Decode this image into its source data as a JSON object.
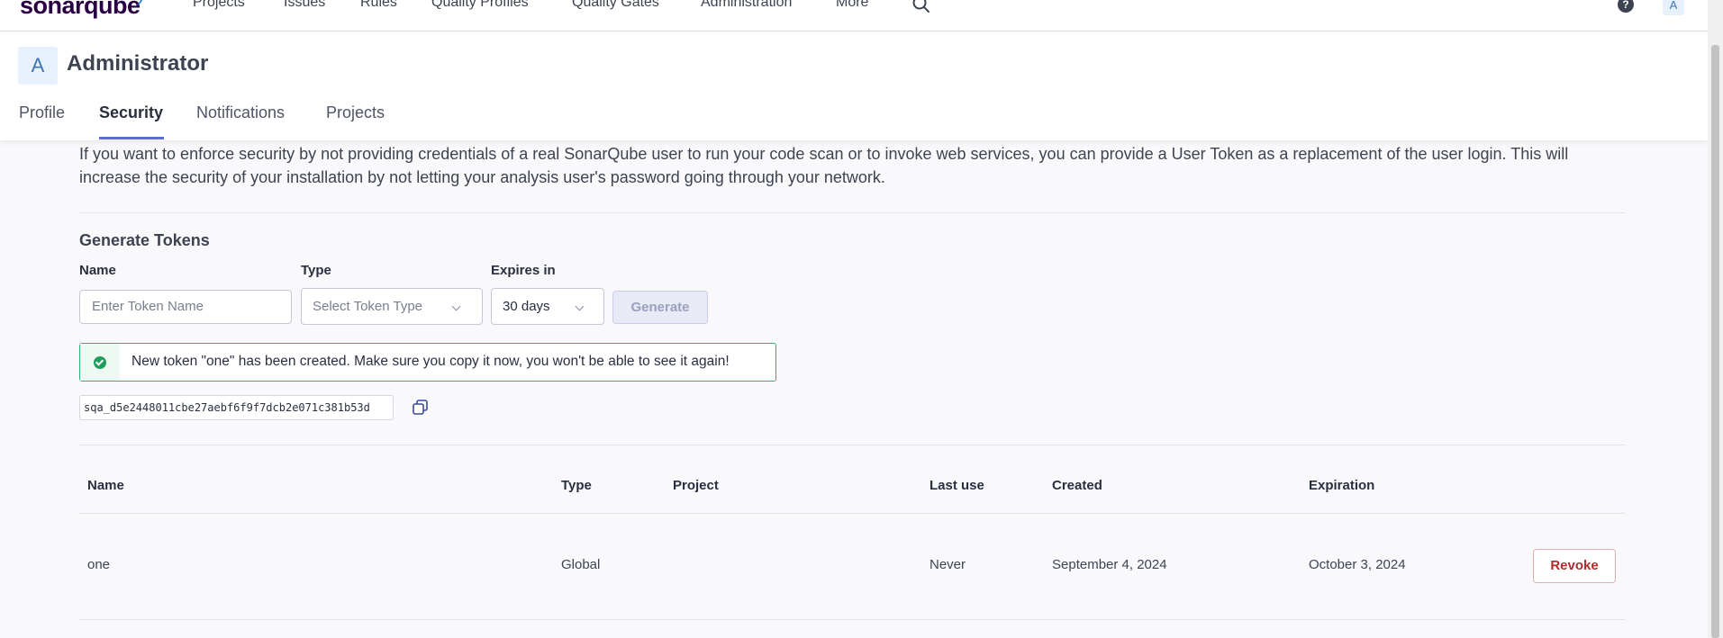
{
  "nav": {
    "logo": "sonarqube",
    "items": [
      "Projects",
      "Issues",
      "Rules",
      "Quality Profiles",
      "Quality Gates",
      "Administration",
      "More"
    ],
    "help": "?",
    "avatar_initial": "A"
  },
  "account": {
    "avatar_initial": "A",
    "name": "Administrator",
    "tabs": [
      "Profile",
      "Security",
      "Notifications",
      "Projects"
    ],
    "active_tab": "Security"
  },
  "security": {
    "description": "If you want to enforce security by not providing credentials of a real SonarQube user to run your code scan or to invoke web services, you can provide a User Token as a replacement of the user login. This will increase the security of your installation by not letting your analysis user's password going through your network.",
    "generate_title": "Generate Tokens",
    "form": {
      "name_label": "Name",
      "name_placeholder": "Enter Token Name",
      "type_label": "Type",
      "type_placeholder": "Select Token Type",
      "expires_label": "Expires in",
      "expires_value": "30 days",
      "generate_label": "Generate"
    },
    "alert": "New token \"one\" has been created. Make sure you copy it now, you won't be able to see it again!",
    "token_value": "sqa_d5e2448011cbe27aebf6f9f7dcb2e071c381b53d"
  },
  "table": {
    "headers": [
      "Name",
      "Type",
      "Project",
      "Last use",
      "Created",
      "Expiration"
    ],
    "rows": [
      {
        "name": "one",
        "type": "Global",
        "project": "",
        "last_use": "Never",
        "created": "September 4, 2024",
        "expiration": "October 3, 2024",
        "action": "Revoke"
      }
    ]
  },
  "colors": {
    "accent": "#5d6cd0",
    "success": "#2bb673",
    "danger": "#b22b2b"
  }
}
